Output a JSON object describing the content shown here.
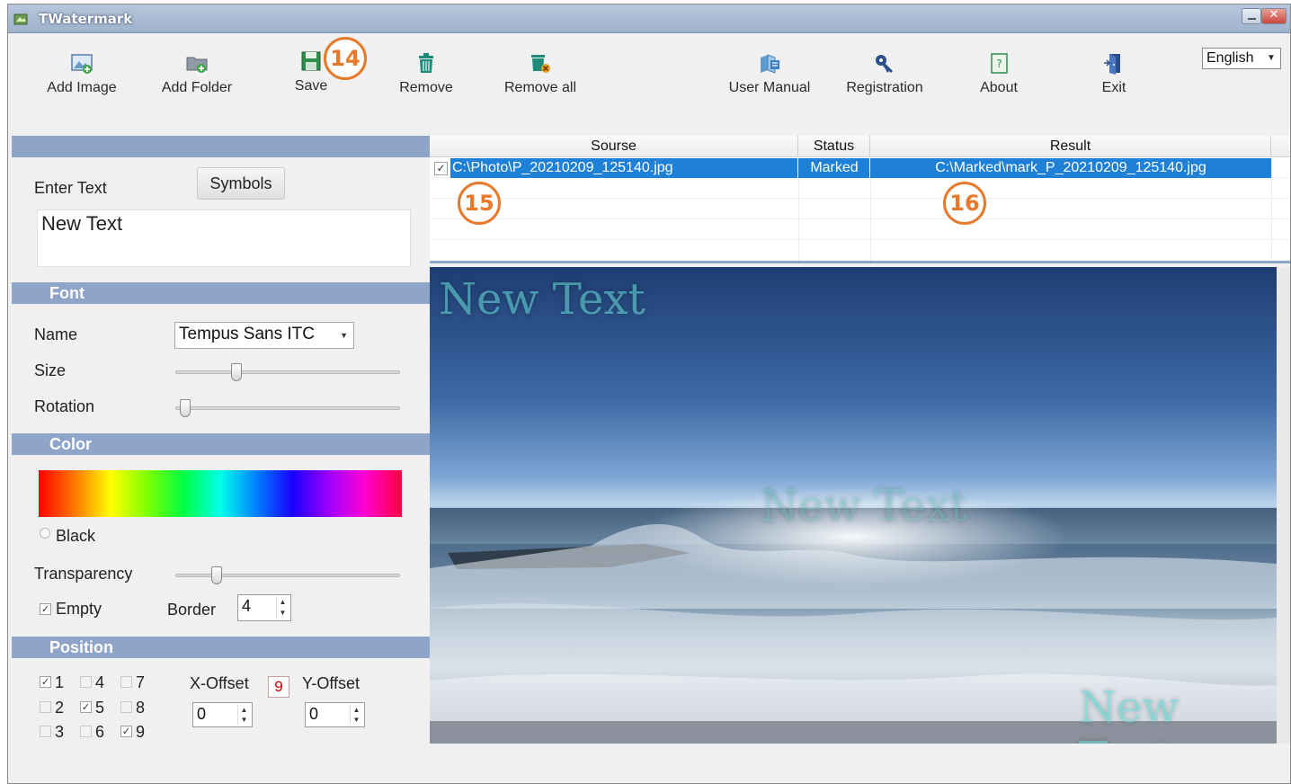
{
  "window": {
    "title": "TWatermark"
  },
  "toolbar": {
    "add_image": "Add Image",
    "add_folder": "Add Folder",
    "save": "Save",
    "remove": "Remove",
    "remove_all": "Remove all",
    "user_manual": "User Manual",
    "registration": "Registration",
    "about": "About",
    "exit": "Exit",
    "language": "English"
  },
  "annotations": {
    "badge_save": "14",
    "badge_source": "15",
    "badge_result": "16"
  },
  "text_section": {
    "enter_text_label": "Enter Text",
    "symbols_button": "Symbols",
    "text_value": "New Text"
  },
  "font_section": {
    "title": "Font",
    "name_label": "Name",
    "name_value": "Tempus Sans ITC",
    "size_label": "Size",
    "size_level": 0.26,
    "rotation_label": "Rotation",
    "rotation_level": 0.02
  },
  "color_section": {
    "title": "Color",
    "black_label": "Black",
    "black_selected": false,
    "transparency_label": "Transparency",
    "transparency_level": 0.17,
    "empty_label": "Empty",
    "empty_checked": true,
    "border_label": "Border",
    "border_value": "4"
  },
  "position_section": {
    "title": "Position",
    "cells": [
      {
        "label": "1",
        "checked": true
      },
      {
        "label": "2",
        "checked": false
      },
      {
        "label": "3",
        "checked": false
      },
      {
        "label": "4",
        "checked": false
      },
      {
        "label": "5",
        "checked": true
      },
      {
        "label": "6",
        "checked": false
      },
      {
        "label": "7",
        "checked": false
      },
      {
        "label": "8",
        "checked": false
      },
      {
        "label": "9",
        "checked": true
      }
    ],
    "x_offset_label": "X-Offset",
    "x_offset_value": "0",
    "selected_position": "9",
    "y_offset_label": "Y-Offset",
    "y_offset_value": "0"
  },
  "file_list": {
    "columns": [
      "Sourse",
      "Status",
      "Result"
    ],
    "rows": [
      {
        "checked": true,
        "source": "C:\\Photo\\P_20210209_125140.jpg",
        "status": "Marked",
        "result": "C:\\Marked\\mark_P_20210209_125140.jpg"
      }
    ]
  },
  "preview": {
    "watermark_text": "New Text",
    "watermark_color": "#6ee6e1"
  }
}
